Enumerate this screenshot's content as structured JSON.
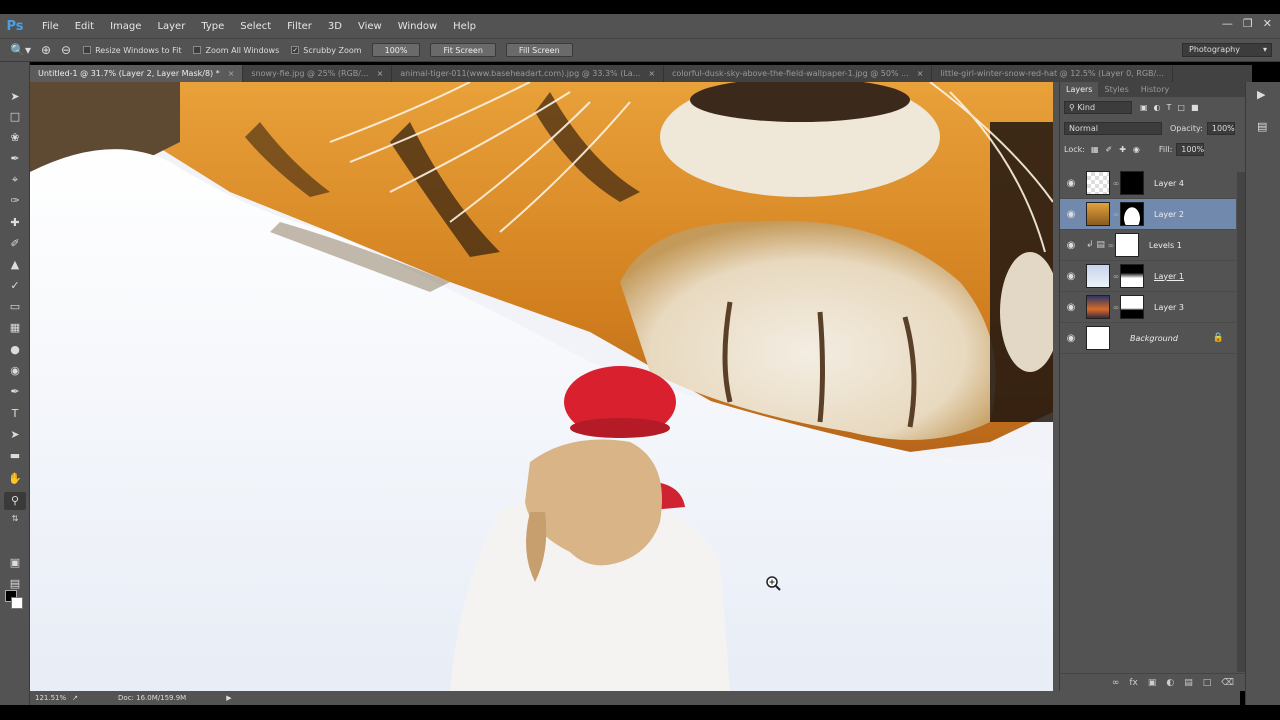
{
  "app": {
    "logo": "Ps"
  },
  "menu": [
    "File",
    "Edit",
    "Image",
    "Layer",
    "Type",
    "Select",
    "Filter",
    "3D",
    "View",
    "Window",
    "Help"
  ],
  "options": {
    "resize_windows": "Resize Windows to Fit",
    "zoom_all": "Zoom All Windows",
    "scrubby_zoom": "Scrubby Zoom",
    "btn_100": "100%",
    "btn_fit": "Fit Screen",
    "btn_fill": "Fill Screen",
    "workspace": "Photography"
  },
  "tabs": [
    "Untitled-1 @ 31.7% (Layer 2, Layer Mask/8) *",
    "snowy-fie.jpg @ 25% (RGB/...",
    "animal-tiger-011(www.baseheadart.com).jpg @ 33.3% (La...",
    "colorful-dusk-sky-above-the-field-wallpaper-1.jpg @ 50% ...",
    "little-girl-winter-snow-red-hat @ 12.5% (Layer 0, RGB/..."
  ],
  "status": {
    "zoom": "121.51%",
    "doc": "Doc: 16.0M/159.9M"
  },
  "panel": {
    "tabs": [
      "Layers",
      "Styles",
      "History"
    ],
    "kind": "Kind",
    "blend": "Normal",
    "opacity_label": "Opacity:",
    "opacity": "100%",
    "lock_label": "Lock:",
    "fill_label": "Fill:",
    "fill": "100%",
    "layers": [
      {
        "name": "Layer 4"
      },
      {
        "name": "Layer 2"
      },
      {
        "name": "Levels 1"
      },
      {
        "name": "Layer 1"
      },
      {
        "name": "Layer 3"
      },
      {
        "name": "Background"
      }
    ]
  },
  "colors": {
    "ui": "#535353",
    "selected": "#7189ac",
    "hat": "#d8202f",
    "fur": "#d98a22"
  }
}
